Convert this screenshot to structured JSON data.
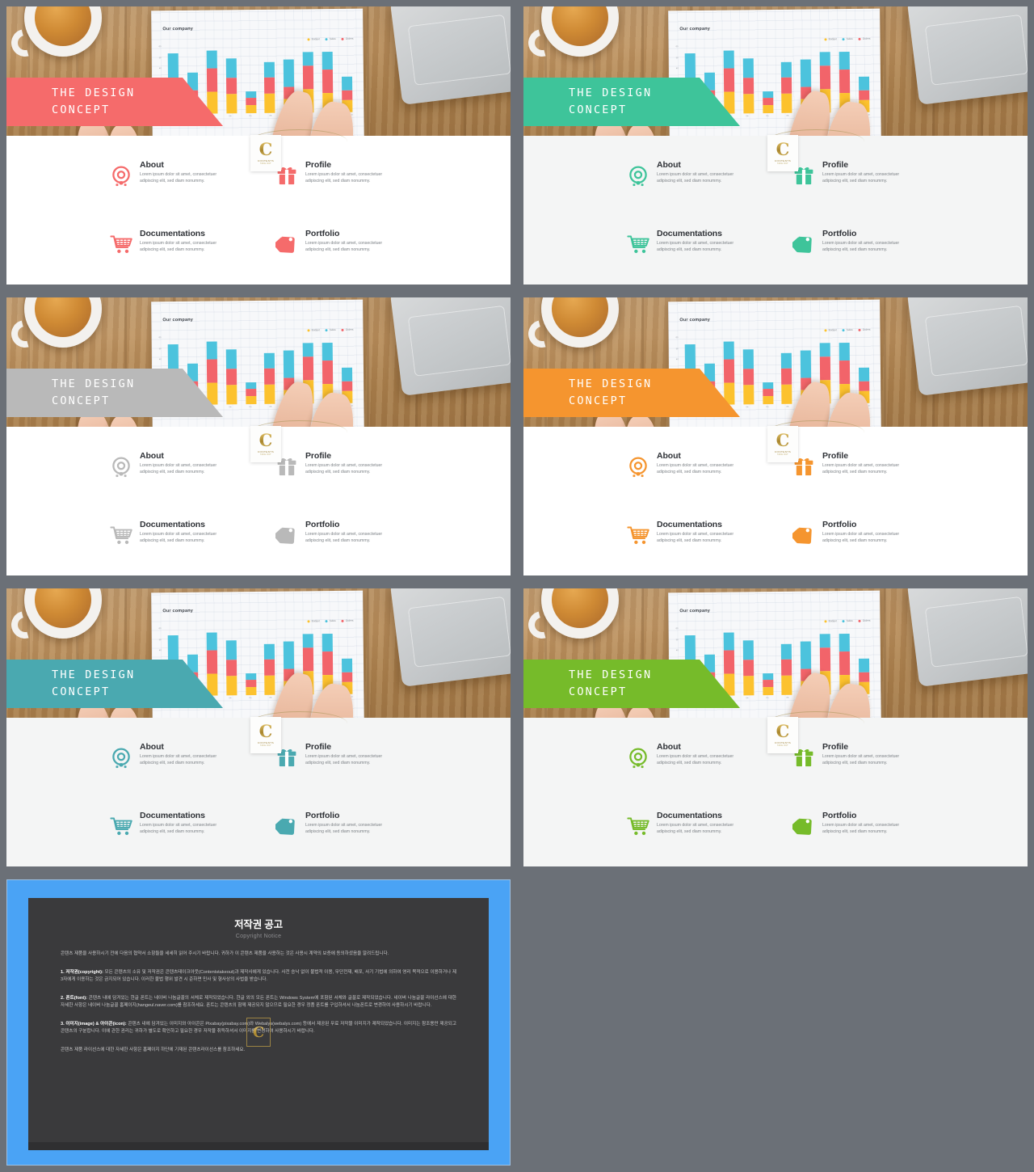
{
  "slides": [
    {
      "accent": "#f56b6b",
      "title_line1": "THE  DESIGN",
      "title_line2": "CONCEPT",
      "body_bg": "#ffffff"
    },
    {
      "accent": "#3ec49a",
      "title_line1": "THE  DESIGN",
      "title_line2": "CONCEPT",
      "body_bg": "#f4f5f5"
    },
    {
      "accent": "#b9b9b9",
      "title_line1": "THE  DESIGN",
      "title_line2": "CONCEPT",
      "body_bg": "#ffffff"
    },
    {
      "accent": "#f5952f",
      "title_line1": "THE  DESIGN",
      "title_line2": "CONCEPT",
      "body_bg": "#ffffff"
    },
    {
      "accent": "#4aa9b0",
      "title_line1": "THE  DESIGN",
      "title_line2": "CONCEPT",
      "body_bg": "#f4f5f5"
    },
    {
      "accent": "#76bb2a",
      "title_line1": "THE  DESIGN",
      "title_line2": "CONCEPT",
      "body_bg": "#f4f5f5"
    }
  ],
  "features": [
    {
      "icon": "target-icon",
      "title": "About",
      "desc": "Lorem ipsum dolor sit amet, consectetuer adipiscing elit, sed diam nonummy."
    },
    {
      "icon": "gift-icon",
      "title": "Profile",
      "desc": "Lorem ipsum dolor sit amet, consectetuer adipiscing elit, sed diam nonummy."
    },
    {
      "icon": "shopping-cart-icon",
      "title": "Documentations",
      "desc": "Lorem ipsum dolor sit amet, consectetuer adipiscing elit, sed diam nonummy."
    },
    {
      "icon": "price-tag-icon",
      "title": "Portfolio",
      "desc": "Lorem ipsum dolor sit amet, consectetuer adipiscing elit, sed diam nonummy."
    }
  ],
  "watermark": {
    "letter": "C",
    "name": "CONTENTS",
    "sub": "TAKE  OUT"
  },
  "photo": {
    "chart_title": "Our company",
    "legend": [
      "Budget",
      "Sales",
      "Orders"
    ],
    "legend_colors": [
      "#fcc22e",
      "#4cc3dd",
      "#f2646a"
    ],
    "y_ticks": [
      "60",
      "50",
      "40",
      "30",
      "20",
      "10",
      "0"
    ],
    "x_ticks": [
      "01",
      "02",
      "03",
      "04",
      "05",
      "06",
      "07",
      "08",
      "09",
      "10"
    ]
  },
  "chart_data": {
    "type": "bar",
    "title": "Our company",
    "categories": [
      "01",
      "02",
      "03",
      "04",
      "05",
      "06",
      "07",
      "08",
      "09",
      "10"
    ],
    "series": [
      {
        "name": "Budget",
        "color": "#fcc22e",
        "values": [
          14,
          10,
          22,
          20,
          8,
          20,
          14,
          24,
          20,
          12
        ]
      },
      {
        "name": "Sales",
        "color": "#f2646a",
        "values": [
          22,
          14,
          24,
          16,
          8,
          16,
          12,
          24,
          24,
          10
        ]
      },
      {
        "name": "Orders",
        "color": "#4cc3dd",
        "values": [
          26,
          18,
          18,
          20,
          6,
          16,
          28,
          14,
          18,
          14
        ]
      }
    ],
    "stacked": true,
    "xlabel": "",
    "ylabel": "",
    "ylim": [
      0,
      70
    ],
    "grid": true,
    "legend_position": "top-right"
  },
  "copyright": {
    "title": "저작권 공고",
    "subtitle": "Copyright Notice",
    "intro": "콘텐츠 제품을 사용하시기 전에 다음의 협약서 소항들을 세세히 읽어 주시기 바랍니다. 귀하가 이 콘텐츠 제품을 사용하는 것은 사용시 계약의 보증에 동의하셨음을 알려드립니다.",
    "s1_label": "1. 저작권(copyright):",
    "s1_text": " 모든 콘텐츠의 소유 및 저작권은 콘텐츠테이크아웃(Contentstakeout)과 제작사에게 있습니다. 사전 승낙 없이 불법적 이용, 무단전재, 배포, 사기 기법에 의하여 영리 목적으로 이용하거나 제3자에게 이용하는 것은 금지되어 있습니다. 이러한 불법 행위 발견 시 준하면 민사 및 형사상의 사법을 받습니다.",
    "s2_label": "2. 폰트(font):",
    "s2_text": " 콘텐츠 내에 담겨있는 한글 폰트는 네이버 나눔글꼴의 서체로 제작되었습니다. 한글 외의 모든 폰트는 Windows System에 포함된 서체와 글꼴로 제작되었습니다. 네이버 나눔글꼴 라이선스에 대한 자세한 사항은 네이버 나눔글꼴 홈페이지(hangeul.naver.com)를 참조하세요. 폰트는 콘텐츠의 함께 제공되지 않으므로 필요한 경우 정품 폰트를 구입하셔서 나눔폰트로 변경하여 사용하시기 바랍니다.",
    "s3_label": "3. 이미지(image) & 아이콘(icon):",
    "s3_text": " 콘텐츠 내에 담겨있는 이미지와 아이콘은 Pixabay(pixabay.com)와 Webalys(webalys.com) 등에서 제공된 무료 저작물 이미지가 제작되었습니다. 이미지는 참조용만 제공되고 콘텐츠의 구분합니다. 이에 관한 권리는 귀하가 별도로 확인하고 필요한 경우 저작물 취득하셔서 이미지를 변경하여 사용하시기 바랍니다.",
    "footer": "콘텐츠 제품 라이선스에 대한 자세한 사항은 홈페이지 하단에 기재된 콘텐츠라이선스를 참조하세요.",
    "watermark_letter": "C"
  }
}
